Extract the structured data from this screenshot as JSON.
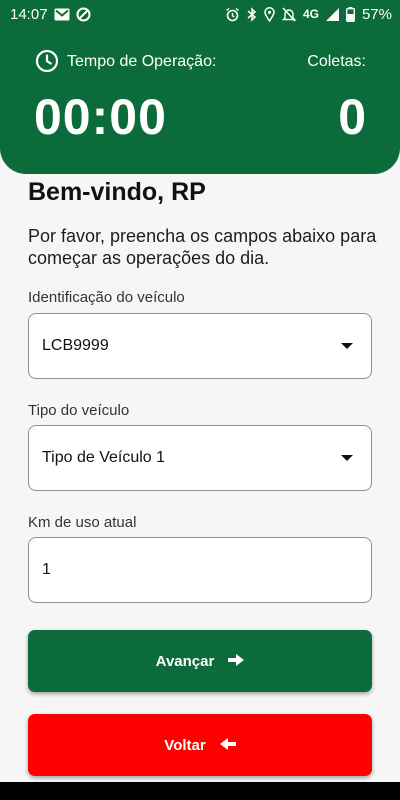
{
  "status_bar": {
    "time": "14:07",
    "network": "4G",
    "battery": "57%",
    "left_icons": [
      "gmail-icon",
      "vpn-icon"
    ],
    "right_icons": [
      "alarm-icon",
      "bluetooth-icon",
      "location-icon",
      "mute-icon",
      "signal-icon",
      "battery-icon"
    ]
  },
  "header": {
    "operation_label": "Tempo de Operação:",
    "operation_time": "00:00",
    "collections_label": "Coletas:",
    "collections_count": "0",
    "background_color": "#0b6b3a"
  },
  "welcome": {
    "title": "Bem-vindo, RP",
    "message": "Por favor, preencha os campos abaixo para começar as operações do dia."
  },
  "form": {
    "vehicle_id_label": "Identificação do veículo",
    "vehicle_id_value": "LCB9999",
    "vehicle_type_label": "Tipo do veículo",
    "vehicle_type_value": "Tipo de Veículo 1",
    "km_label": "Km de uso atual",
    "km_value": "1"
  },
  "actions": {
    "next_label": "Avançar",
    "back_label": "Voltar",
    "next_color": "#0b6b3a",
    "back_color": "#ff0000"
  }
}
